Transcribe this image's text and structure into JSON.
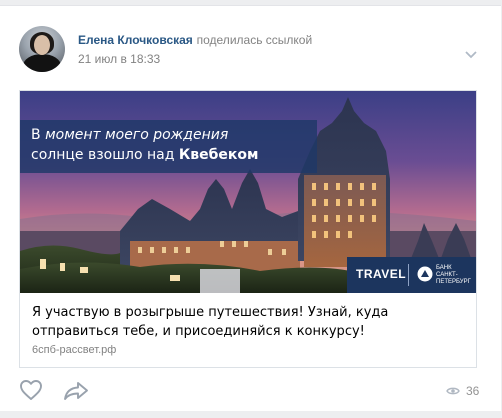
{
  "post": {
    "author_name": "Елена Клочковская",
    "action": "поделилась ссылкой",
    "date": "21 июл в 18:33"
  },
  "ad": {
    "headline_line1_prefix": "В ",
    "headline_line1_italic": "момент моего рождения",
    "headline_line2_prefix": "солнце взошло над ",
    "headline_line2_bold": "Квебеком",
    "travel_label": "TRAVEL",
    "bank_name": "БАНК\nСАНКТ-\nПЕТЕРБУРГ"
  },
  "link": {
    "text": "Я участвую в розыгрыше путешествия! Узнай, куда отправиться тебе, и присоединяйся к конкурсу!",
    "domain": "6спб-рассвет.рф"
  },
  "footer": {
    "views": "36"
  },
  "icons": {
    "like": "heart-icon",
    "share": "share-arrow-icon",
    "views": "eye-icon",
    "menu": "chevron-down-icon"
  },
  "colors": {
    "author_link": "#2a5885",
    "muted": "#828282",
    "banner_blue": "#1c355e"
  }
}
